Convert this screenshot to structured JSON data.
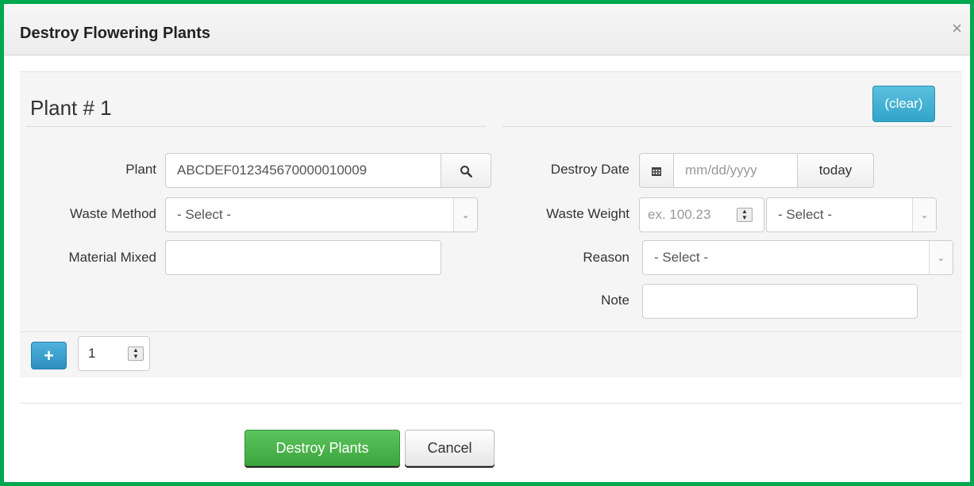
{
  "dialog": {
    "title": "Destroy Flowering Plants",
    "close_glyph": "×"
  },
  "plant": {
    "heading": "Plant # 1",
    "clear_label": "(clear)",
    "fields": {
      "plant_label": "Plant",
      "plant_value": "ABCDEF012345670000010009",
      "waste_method_label": "Waste Method",
      "waste_method_value": "- Select -",
      "material_mixed_label": "Material Mixed",
      "material_mixed_value": "",
      "destroy_date_label": "Destroy Date",
      "destroy_date_placeholder": "mm/dd/yyyy",
      "today_label": "today",
      "waste_weight_label": "Waste Weight",
      "waste_weight_placeholder": "ex. 100.23",
      "waste_unit_value": "- Select -",
      "reason_label": "Reason",
      "reason_value": "- Select -",
      "note_label": "Note",
      "note_value": ""
    }
  },
  "add_row": {
    "plus_glyph": "+",
    "count_value": "1"
  },
  "actions": {
    "submit_label": "Destroy Plants",
    "cancel_label": "Cancel"
  },
  "colors": {
    "frame": "#00a84f",
    "info_button": "#31a4c9",
    "success_button": "#3da53d"
  },
  "icons": {
    "search": "search-icon",
    "calendar": "calendar-icon",
    "close": "close-icon",
    "plus": "plus-icon",
    "chevron": "chevron-down-icon"
  }
}
